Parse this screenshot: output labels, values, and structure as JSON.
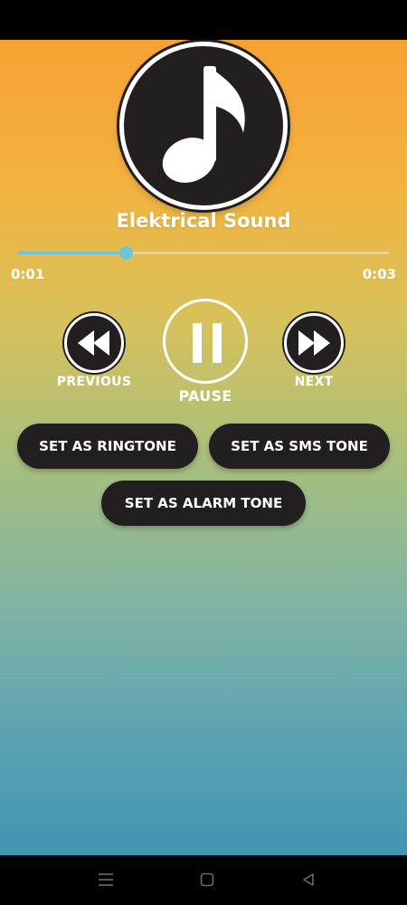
{
  "player": {
    "album_icon": "music-note-icon",
    "track_title": "Elektrical Sound",
    "progress_fraction": 0.29,
    "time_current": "0:01",
    "time_total": "0:03",
    "accent_color": "#6ec3d6"
  },
  "controls": {
    "previous_label": "PREVIOUS",
    "previous_icon": "rewind-icon",
    "pause_label": "PAUSE",
    "pause_icon": "pause-icon",
    "next_label": "NEXT",
    "next_icon": "fast-forward-icon"
  },
  "actions": {
    "ringtone_label": "SET AS RINGTONE",
    "sms_label": "SET AS SMS TONE",
    "alarm_label": "SET AS ALARM TONE"
  },
  "navigation": {
    "menu_icon": "recent-apps-icon",
    "home_icon": "home-icon",
    "back_icon": "back-icon"
  }
}
